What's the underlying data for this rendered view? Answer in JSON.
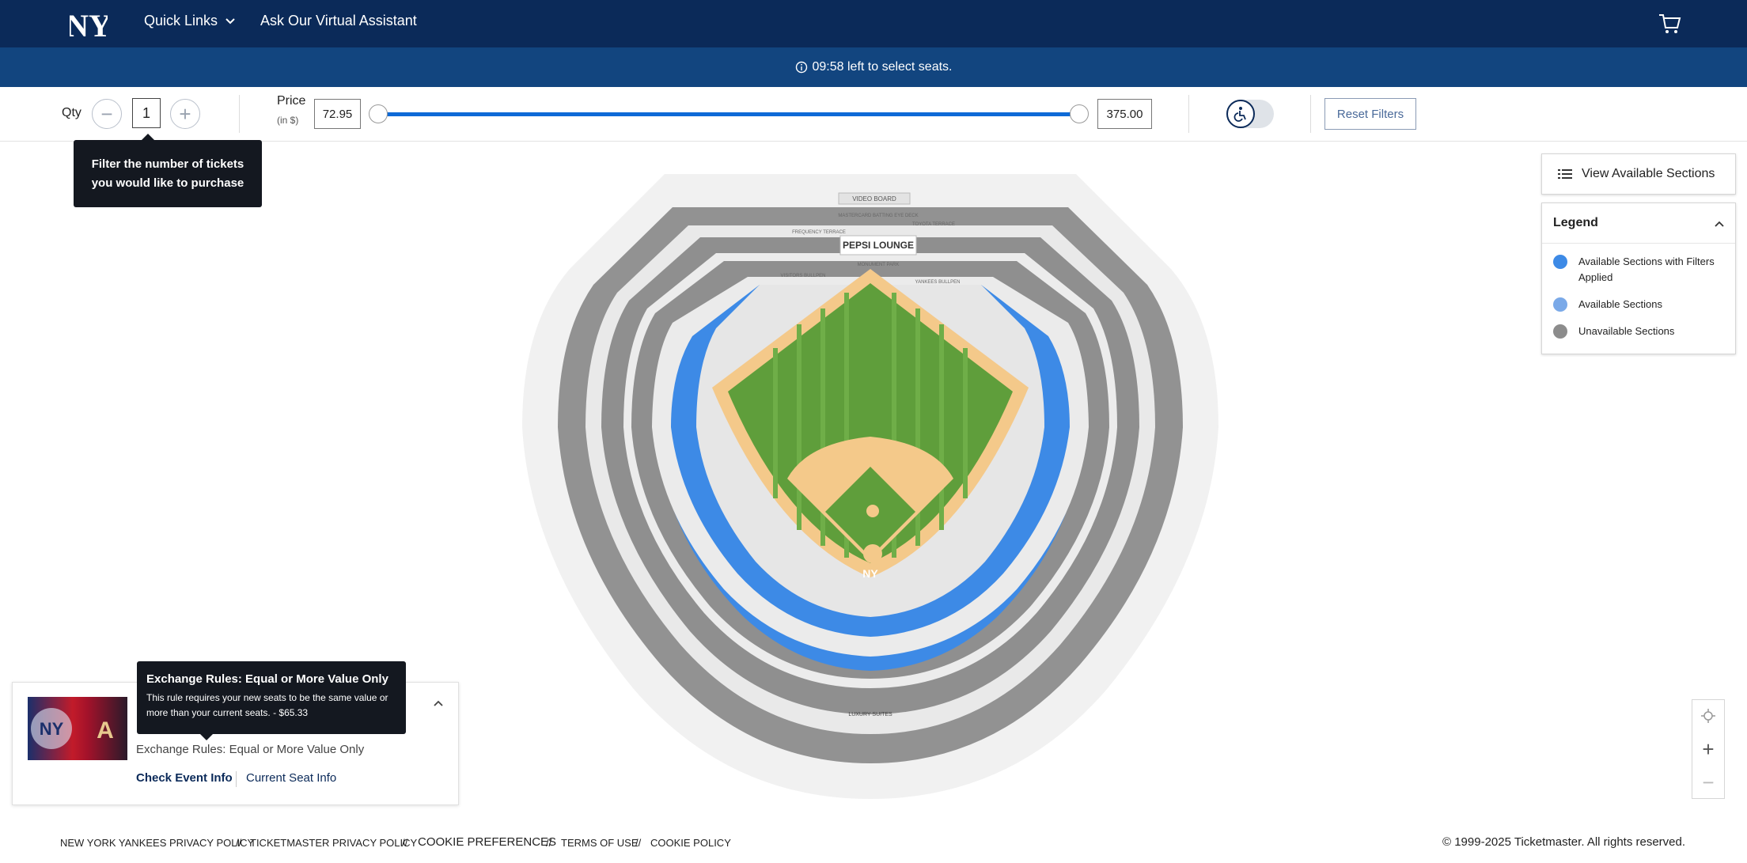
{
  "nav": {
    "quick_links": "Quick Links",
    "assistant": "Ask Our Virtual Assistant"
  },
  "timer": {
    "text": "09:58 left to select seats."
  },
  "filters": {
    "qty_label": "Qty",
    "qty_value": "1",
    "price_label": "Price",
    "price_sub": "(in $)",
    "price_min": "72.95",
    "price_max": "375.00",
    "reset_label": "Reset Filters"
  },
  "qty_tooltip": "Filter the number of tickets you would like to purchase",
  "view_sections_label": "View Available Sections",
  "legend": {
    "title": "Legend",
    "items": [
      {
        "label": "Available Sections with Filters Applied",
        "color": "#3d8ae6"
      },
      {
        "label": "Available Sections",
        "color": "#7aa9e8"
      },
      {
        "label": "Unavailable Sections",
        "color": "#8c8c8c"
      }
    ]
  },
  "map": {
    "labels": {
      "video_board": "VIDEO BOARD",
      "pepsi_lounge": "PEPSI LOUNGE",
      "luxury_suites": "LUXURY SUITES",
      "mastercard": "MASTERCARD BATTING EYE DECK",
      "monument": "MONUMENT PARK",
      "toyota": "TOYOTA TERRACE",
      "frequency": "FREQUENCY TERRACE",
      "bullpen_l": "YANKEES BULLPEN",
      "bullpen_r": "VISITORS BULLPEN"
    },
    "colors": {
      "available": "#3d8ae6",
      "unavailable": "#8c8c8c",
      "field": "#5f9e3b",
      "dirt": "#f4c98a"
    }
  },
  "event": {
    "rules_line": "Exchange Rules: Equal or More Value Only",
    "check_event": "Check Event Info",
    "current_seat": "Current Seat Info"
  },
  "rules_tooltip": {
    "title": "Exchange Rules: Equal or More Value Only",
    "body": "This rule requires your new seats to be the same value or more than your current seats. - $65.33"
  },
  "footer": {
    "links": [
      "NEW YORK YANKEES PRIVACY POLICY",
      "TICKETMASTER PRIVACY POLICY",
      "COOKIE PREFERENCES",
      "TERMS OF USE",
      "COOKIE POLICY"
    ],
    "separator": "//",
    "copyright": "© 1999-2025 Ticketmaster. All rights reserved."
  }
}
